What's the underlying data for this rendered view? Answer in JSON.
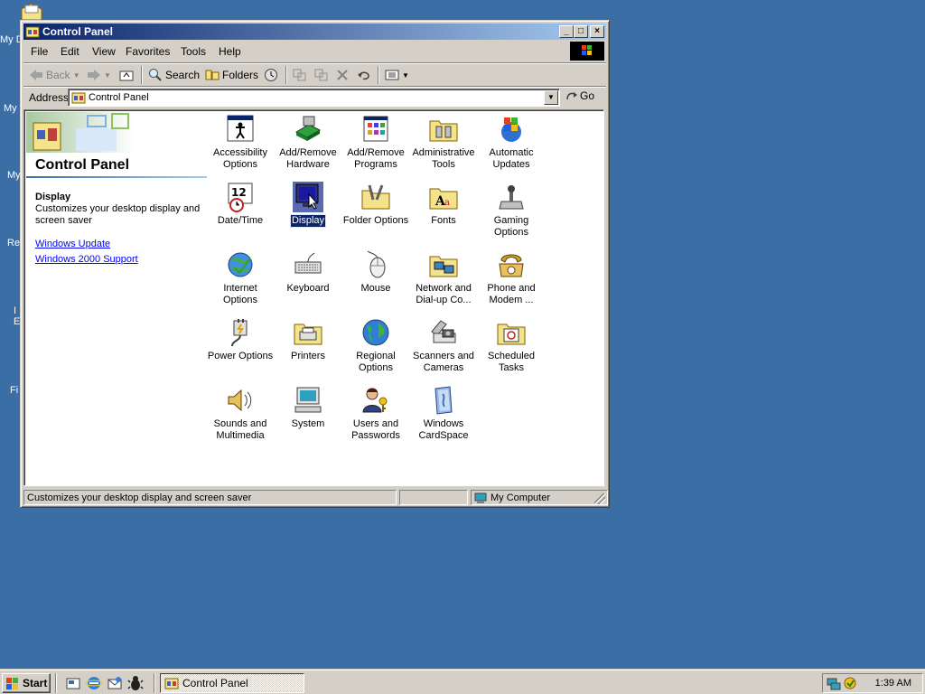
{
  "desktop": {
    "icons": [
      {
        "label": "My D"
      },
      {
        "label": "My"
      },
      {
        "label": "My"
      },
      {
        "label": "Re"
      },
      {
        "label": "I"
      },
      {
        "label": "E"
      },
      {
        "label": "Fi"
      }
    ]
  },
  "window": {
    "title": "Control Panel",
    "controls": {
      "minimize": "_",
      "maximize": "□",
      "close": "×"
    },
    "menu": [
      "File",
      "Edit",
      "View",
      "Favorites",
      "Tools",
      "Help"
    ],
    "toolbar": {
      "back": "Back",
      "search": "Search",
      "folders": "Folders"
    },
    "address": {
      "label": "Address",
      "value": "Control Panel",
      "go": "Go"
    }
  },
  "sidebar": {
    "title": "Control Panel",
    "selected_name": "Display",
    "selected_desc": "Customizes your desktop display and screen saver",
    "links": [
      "Windows Update",
      "Windows 2000 Support"
    ]
  },
  "items": [
    {
      "label": "Accessibility Options",
      "icon": "accessibility-icon"
    },
    {
      "label": "Add/Remove Hardware",
      "icon": "add-remove-hardware-icon"
    },
    {
      "label": "Add/Remove Programs",
      "icon": "add-remove-programs-icon"
    },
    {
      "label": "Administrative Tools",
      "icon": "administrative-tools-icon"
    },
    {
      "label": "Automatic Updates",
      "icon": "automatic-updates-icon"
    },
    {
      "label": "Date/Time",
      "icon": "date-time-icon"
    },
    {
      "label": "Display",
      "icon": "display-icon",
      "selected": true
    },
    {
      "label": "Folder Options",
      "icon": "folder-options-icon"
    },
    {
      "label": "Fonts",
      "icon": "fonts-icon"
    },
    {
      "label": "Gaming Options",
      "icon": "gaming-options-icon"
    },
    {
      "label": "Internet Options",
      "icon": "internet-options-icon"
    },
    {
      "label": "Keyboard",
      "icon": "keyboard-icon"
    },
    {
      "label": "Mouse",
      "icon": "mouse-icon"
    },
    {
      "label": "Network and Dial-up Co...",
      "icon": "network-icon"
    },
    {
      "label": "Phone and Modem ...",
      "icon": "phone-modem-icon"
    },
    {
      "label": "Power Options",
      "icon": "power-options-icon"
    },
    {
      "label": "Printers",
      "icon": "printers-icon"
    },
    {
      "label": "Regional Options",
      "icon": "regional-options-icon"
    },
    {
      "label": "Scanners and Cameras",
      "icon": "scanners-cameras-icon"
    },
    {
      "label": "Scheduled Tasks",
      "icon": "scheduled-tasks-icon"
    },
    {
      "label": "Sounds and Multimedia",
      "icon": "sounds-multimedia-icon"
    },
    {
      "label": "System",
      "icon": "system-icon"
    },
    {
      "label": "Users and Passwords",
      "icon": "users-passwords-icon"
    },
    {
      "label": "Windows CardSpace",
      "icon": "windows-cardspace-icon"
    }
  ],
  "statusbar": {
    "text": "Customizes your desktop display and screen saver",
    "zone": "My Computer"
  },
  "taskbar": {
    "start": "Start",
    "task": "Control Panel",
    "clock": "1:39 AM"
  },
  "colors": {
    "desktop": "#3a6ea5",
    "titlebar_start": "#0a246a",
    "titlebar_end": "#a6caf0",
    "face": "#d4d0c8",
    "selection": "#0a246a",
    "link": "#0000ff"
  }
}
